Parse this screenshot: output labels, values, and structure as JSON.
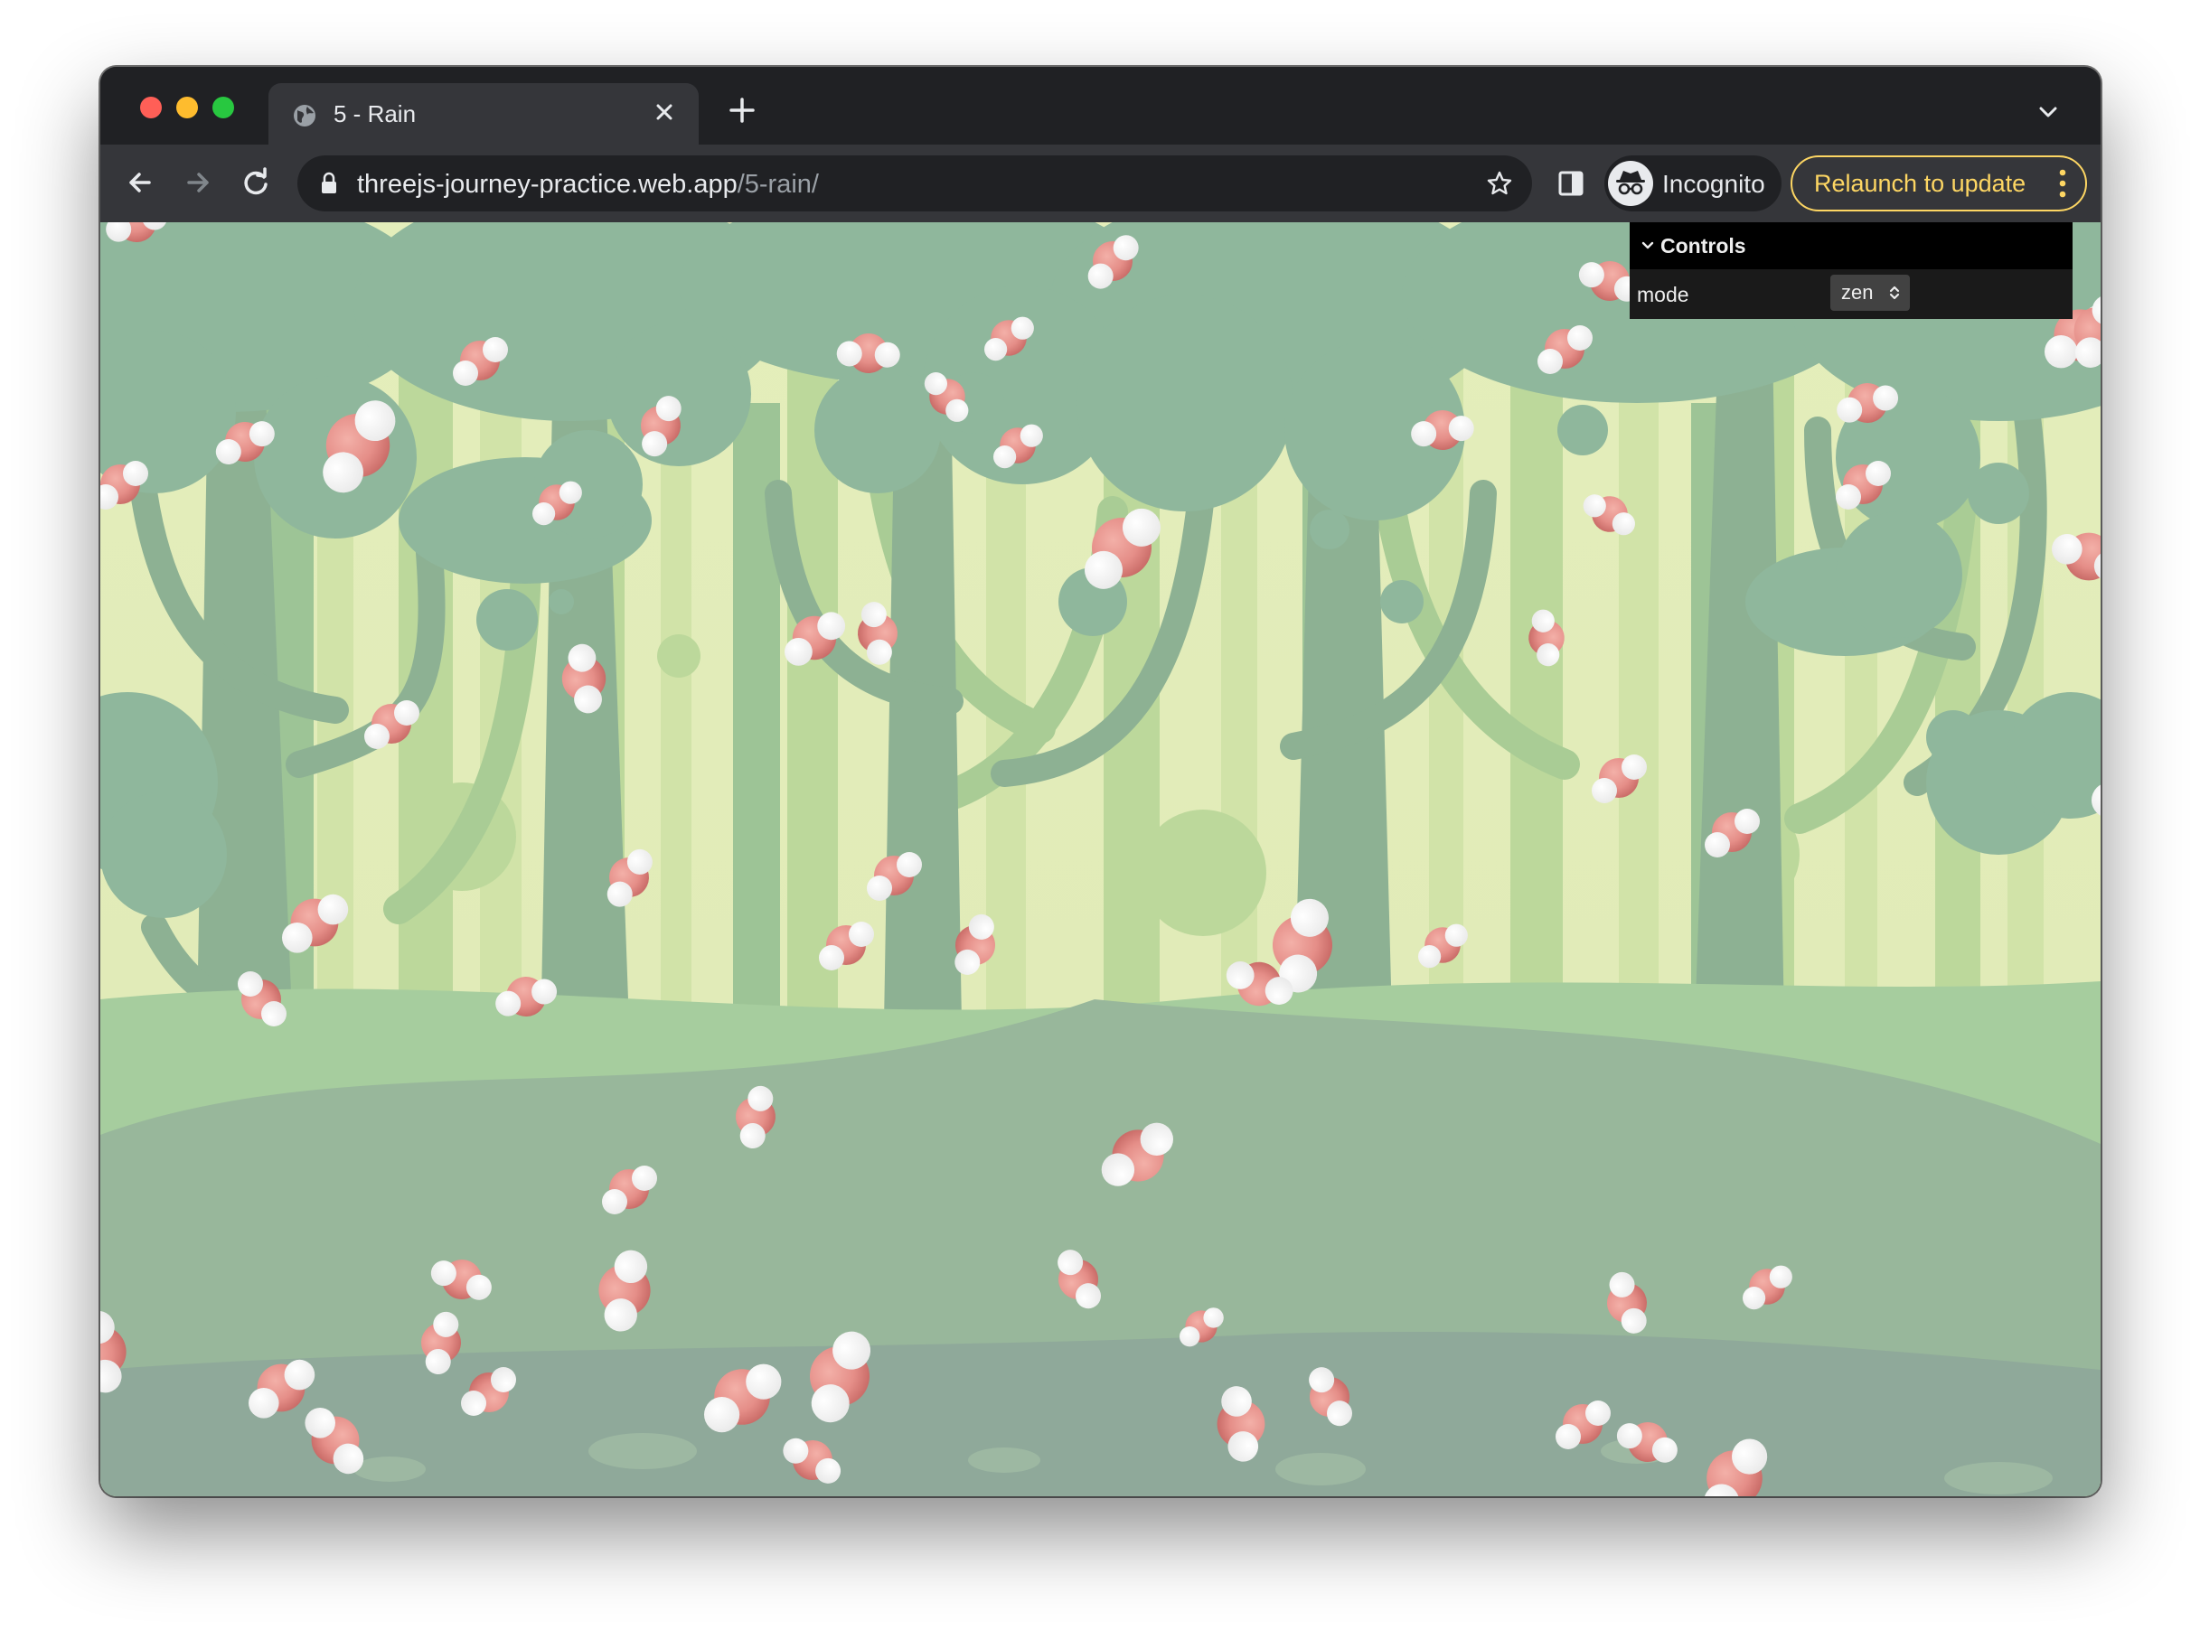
{
  "browser": {
    "tab": {
      "title": "5 - Rain",
      "favicon": "globe-icon",
      "close_icon": "close-icon"
    },
    "new_tab_icon": "plus-icon",
    "tab_search_icon": "chevron-down-icon",
    "address_bar": {
      "host": "threejs-journey-practice.web.app",
      "path": "/5-rain/",
      "lock_icon": "lock-icon",
      "bookmark_icon": "star-icon"
    },
    "profile": {
      "label": "Incognito",
      "icon": "incognito-icon"
    },
    "relaunch_label": "Relaunch to update",
    "colors": {
      "relaunch_accent": "#fdd663",
      "frame": "#202124",
      "toolbar": "#35363a"
    }
  },
  "controls": {
    "title": "Controls",
    "rows": [
      {
        "label": "mode",
        "value": "zen"
      }
    ]
  },
  "scene": {
    "description_icons": [
      "water-molecule-icon"
    ],
    "colors": {
      "oxygen": "#e07b7b",
      "hydrogen": "#ffffff",
      "sky": "#e7efbd",
      "trees": "#8fb59a"
    }
  }
}
